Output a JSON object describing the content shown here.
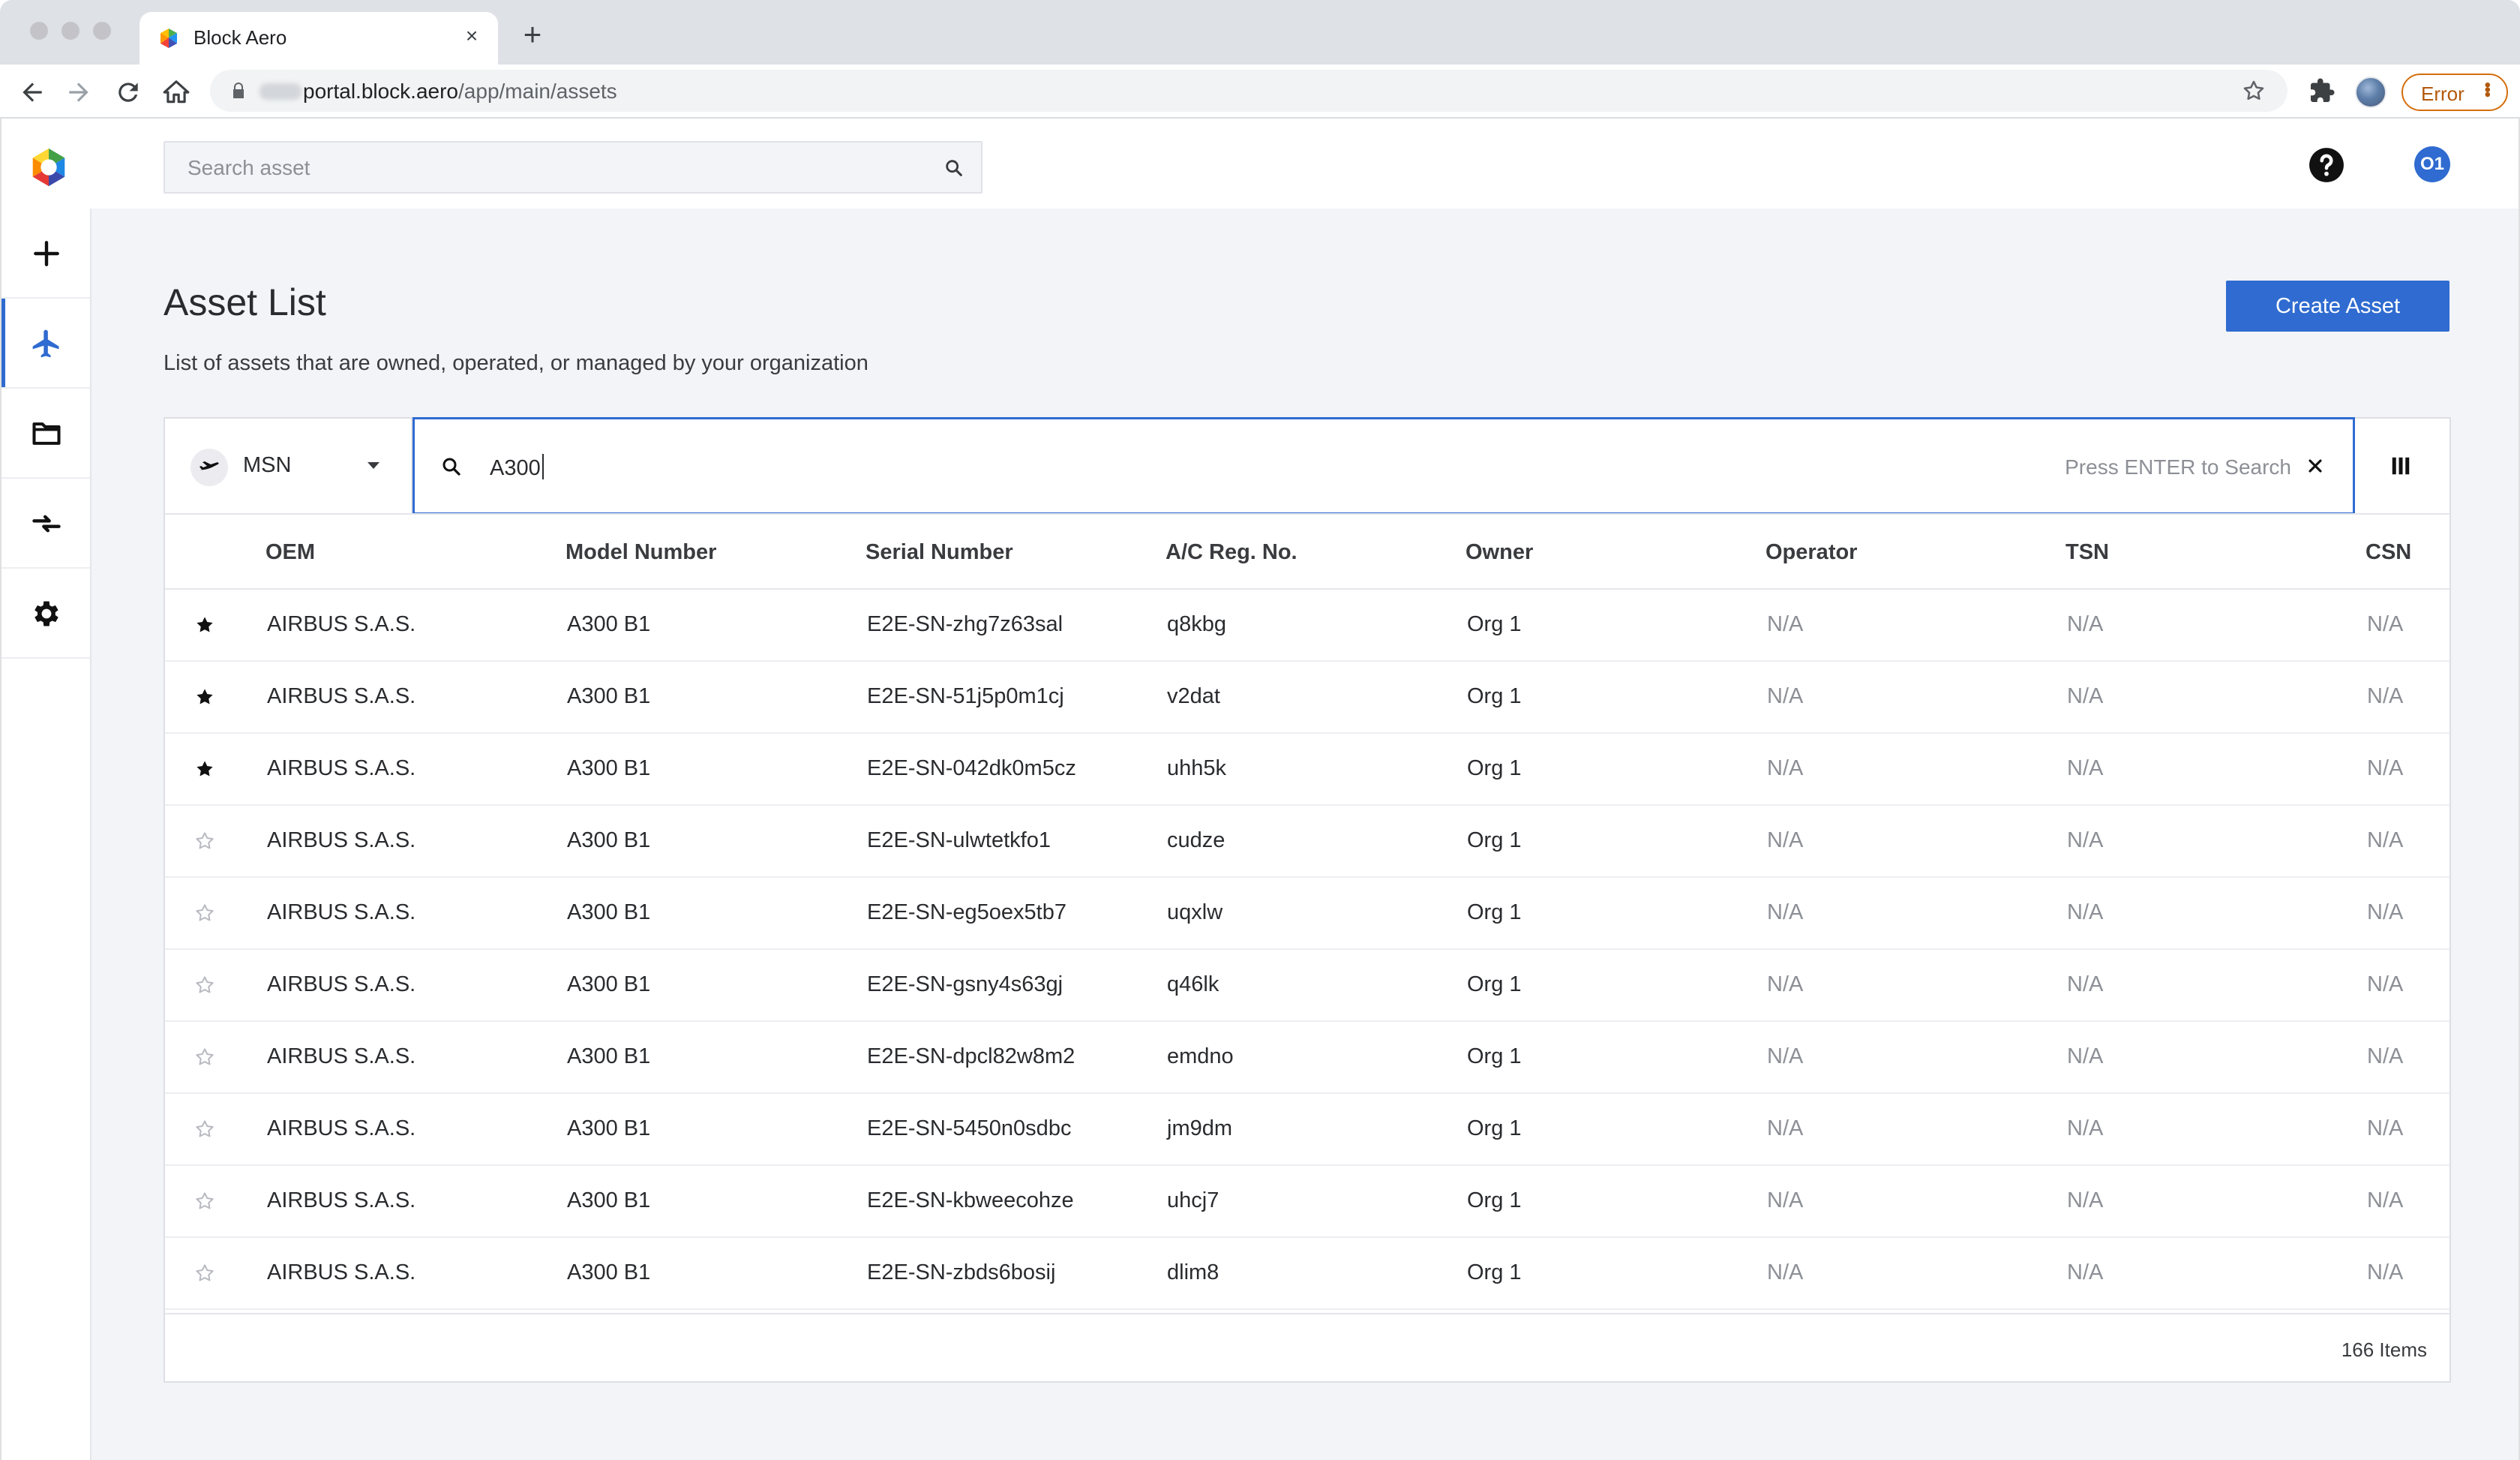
{
  "browser": {
    "tab_title": "Block Aero",
    "url_host": "portal.block.aero",
    "url_path": "/app/main/assets",
    "profile_status": "Error"
  },
  "header": {
    "search_placeholder": "Search asset",
    "user_initials": "O1"
  },
  "sidenav": {
    "items": [
      {
        "name": "add",
        "icon": "plus-icon"
      },
      {
        "name": "assets",
        "icon": "airplane-icon",
        "active": true
      },
      {
        "name": "documents",
        "icon": "folder-icon"
      },
      {
        "name": "transfers",
        "icon": "transfer-arrows-icon"
      },
      {
        "name": "settings",
        "icon": "gear-icon"
      }
    ]
  },
  "page": {
    "title": "Asset List",
    "subtitle": "List of assets that are owned, operated, or managed by your organization",
    "create_button": "Create Asset"
  },
  "filter": {
    "field": "MSN",
    "query": "A300",
    "hint": "Press ENTER to Search"
  },
  "table": {
    "columns": [
      "OEM",
      "Model Number",
      "Serial Number",
      "A/C Reg. No.",
      "Owner",
      "Operator",
      "TSN",
      "CSN"
    ],
    "rows": [
      {
        "favorite": true,
        "oem": "AIRBUS S.A.S.",
        "model": "A300 B1",
        "serial": "E2E-SN-zhg7z63sal",
        "reg": "q8kbg",
        "owner": "Org 1",
        "operator": "N/A",
        "tsn": "N/A",
        "csn": "N/A"
      },
      {
        "favorite": true,
        "oem": "AIRBUS S.A.S.",
        "model": "A300 B1",
        "serial": "E2E-SN-51j5p0m1cj",
        "reg": "v2dat",
        "owner": "Org 1",
        "operator": "N/A",
        "tsn": "N/A",
        "csn": "N/A"
      },
      {
        "favorite": true,
        "oem": "AIRBUS S.A.S.",
        "model": "A300 B1",
        "serial": "E2E-SN-042dk0m5cz",
        "reg": "uhh5k",
        "owner": "Org 1",
        "operator": "N/A",
        "tsn": "N/A",
        "csn": "N/A"
      },
      {
        "favorite": false,
        "oem": "AIRBUS S.A.S.",
        "model": "A300 B1",
        "serial": "E2E-SN-ulwtetkfo1",
        "reg": "cudze",
        "owner": "Org 1",
        "operator": "N/A",
        "tsn": "N/A",
        "csn": "N/A"
      },
      {
        "favorite": false,
        "oem": "AIRBUS S.A.S.",
        "model": "A300 B1",
        "serial": "E2E-SN-eg5oex5tb7",
        "reg": "uqxlw",
        "owner": "Org 1",
        "operator": "N/A",
        "tsn": "N/A",
        "csn": "N/A"
      },
      {
        "favorite": false,
        "oem": "AIRBUS S.A.S.",
        "model": "A300 B1",
        "serial": "E2E-SN-gsny4s63gj",
        "reg": "q46lk",
        "owner": "Org 1",
        "operator": "N/A",
        "tsn": "N/A",
        "csn": "N/A"
      },
      {
        "favorite": false,
        "oem": "AIRBUS S.A.S.",
        "model": "A300 B1",
        "serial": "E2E-SN-dpcl82w8m2",
        "reg": "emdno",
        "owner": "Org 1",
        "operator": "N/A",
        "tsn": "N/A",
        "csn": "N/A"
      },
      {
        "favorite": false,
        "oem": "AIRBUS S.A.S.",
        "model": "A300 B1",
        "serial": "E2E-SN-5450n0sdbc",
        "reg": "jm9dm",
        "owner": "Org 1",
        "operator": "N/A",
        "tsn": "N/A",
        "csn": "N/A"
      },
      {
        "favorite": false,
        "oem": "AIRBUS S.A.S.",
        "model": "A300 B1",
        "serial": "E2E-SN-kbweecohze",
        "reg": "uhcj7",
        "owner": "Org 1",
        "operator": "N/A",
        "tsn": "N/A",
        "csn": "N/A"
      },
      {
        "favorite": false,
        "oem": "AIRBUS S.A.S.",
        "model": "A300 B1",
        "serial": "E2E-SN-zbds6bosij",
        "reg": "dlim8",
        "owner": "Org 1",
        "operator": "N/A",
        "tsn": "N/A",
        "csn": "N/A"
      }
    ],
    "item_count": "166 Items"
  },
  "colors": {
    "accent": "#2f6bd0",
    "background": "#f3f4f8",
    "error": "#d56e0c"
  }
}
